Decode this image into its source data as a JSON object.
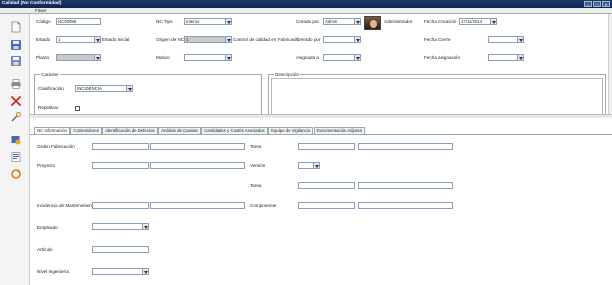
{
  "window": {
    "title": "Calidad (No Conformidad)"
  },
  "menu": {
    "file": "Fitxer"
  },
  "header": {
    "codigo_label": "Código",
    "codigo_value": "NC00096",
    "nctipo_label": "NC Tipo",
    "nctipo_value": "Interno",
    "creadopor_label": "Creado por",
    "creadopor_value": "Admin",
    "creadopor_name": "Administrador",
    "fechacreacion_label": "Fecha Creación",
    "fechacreacion_value": "17/11/2014",
    "estado_label": "Estado",
    "estado_value": "1",
    "estado_text": "Estado Inicial",
    "origen_label": "Origen de NC",
    "origen_value": "1",
    "origen_text": "Control de calidad en Fabricació",
    "cerradopor_label": "Cerrado por",
    "cerradopor_value": "",
    "fechacierre_label": "Fecha Cierre",
    "fechacierre_value": "",
    "planta_label": "Planta",
    "planta_value": "",
    "motivo_label": "Motivo",
    "motivo_value": "",
    "asignado_label": "Asignado a",
    "asignado_value": "",
    "fechaasign_label": "Fecha asignación",
    "fechaasign_value": ""
  },
  "caracter": {
    "title": "Carácter",
    "clasificacion_label": "Clasificación",
    "clasificacion_value": "INCIDENCIA",
    "repetitivo_label": "Repetitivo"
  },
  "descripcion": {
    "title": "Descripción",
    "value": ""
  },
  "tabs": [
    "NC Información",
    "Contenidores",
    "Identificación de Defectos",
    "Análisis de Causas",
    "Cantidades y Costes Asociados",
    "Equipo de Vigilancia",
    "Documentación Adjunta"
  ],
  "detail": {
    "orden_label": "Orden Fabricación",
    "tarea_label": "Tarea",
    "proyecto_label": "Proyecto",
    "version_label": "Versión",
    "tarea2_label": "Tarea",
    "incidencia_label": "Incidencia de Mantenimiento",
    "componente_label": "Componente",
    "empleado_label": "Empleado",
    "articulo_label": "Artículo",
    "nivel_label": "Nivel Ingeniería"
  },
  "icons": [
    "new-document-icon",
    "save-icon",
    "save-as-icon",
    "print-icon",
    "delete-icon",
    "tools-icon",
    "users-icon",
    "report-icon",
    "refresh-icon"
  ],
  "colors": {
    "title_bar": "#1d3a6e",
    "field_border": "#8a9fbd",
    "disabled_field": "#c9c9c9"
  }
}
